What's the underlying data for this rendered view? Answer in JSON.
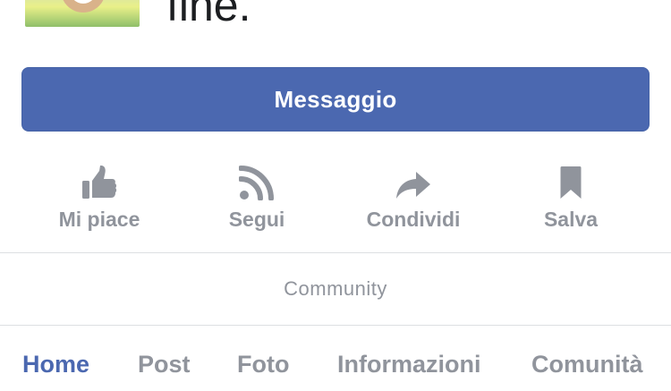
{
  "header": {
    "title_fragment": "fine."
  },
  "primary_action": {
    "label": "Messaggio"
  },
  "actions": [
    {
      "label": "Mi piace",
      "icon": "thumbs-up-icon"
    },
    {
      "label": "Segui",
      "icon": "rss-icon"
    },
    {
      "label": "Condividi",
      "icon": "share-arrow-icon"
    },
    {
      "label": "Salva",
      "icon": "bookmark-icon"
    }
  ],
  "section": {
    "label": "Community"
  },
  "tabs": [
    {
      "label": "Home",
      "active": true
    },
    {
      "label": "Post",
      "active": false
    },
    {
      "label": "Foto",
      "active": false
    },
    {
      "label": "Informazioni",
      "active": false
    },
    {
      "label": "Comunità",
      "active": false
    }
  ],
  "colors": {
    "accent": "#4b68b0",
    "muted": "#90949c",
    "divider": "#dddfe2",
    "text": "#1c1e21"
  }
}
